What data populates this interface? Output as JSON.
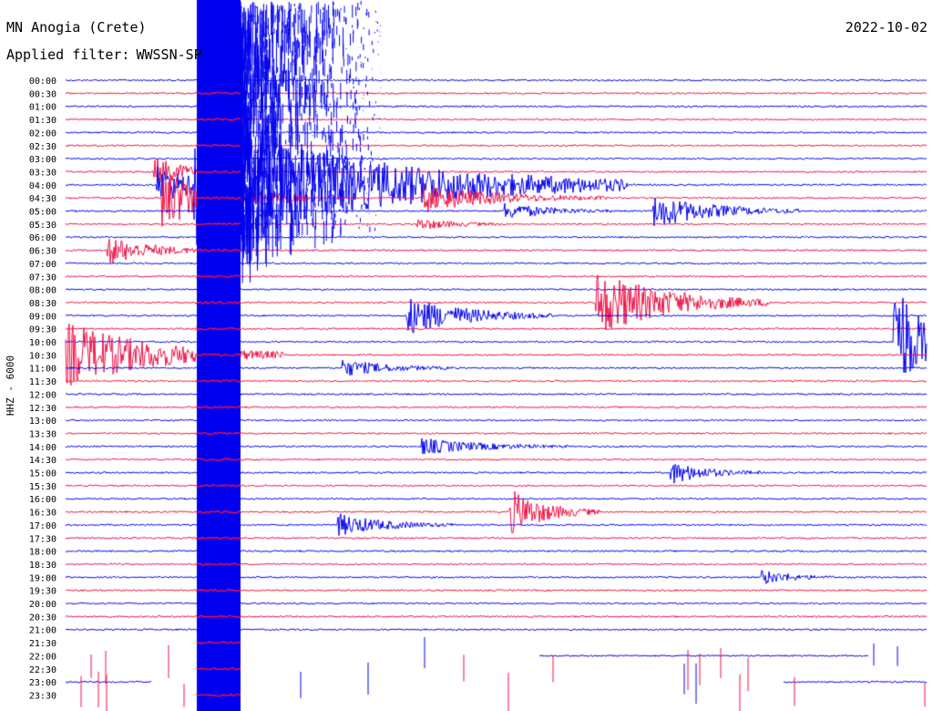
{
  "header": {
    "station": "MN Anogia (Crete)",
    "date": "2022-10-02",
    "filter_label": "Applied filter:",
    "filter_value": "WWSSN-SP"
  },
  "chart_data": {
    "type": "line",
    "title": "MN Anogia (Crete)",
    "ylabel": "HHZ - 6000",
    "rows": [
      "00:00",
      "00:30",
      "01:00",
      "01:30",
      "02:00",
      "02:30",
      "03:00",
      "03:30",
      "04:00",
      "04:30",
      "05:00",
      "05:30",
      "06:00",
      "06:30",
      "07:00",
      "07:30",
      "08:00",
      "08:30",
      "09:00",
      "09:30",
      "10:00",
      "10:30",
      "11:00",
      "11:30",
      "12:00",
      "12:30",
      "13:00",
      "13:30",
      "14:00",
      "14:30",
      "15:00",
      "15:30",
      "16:00",
      "16:30",
      "17:00",
      "17:30",
      "18:00",
      "18:30",
      "19:00",
      "19:30",
      "20:00",
      "20:30",
      "21:00",
      "21:30",
      "22:00",
      "22:30",
      "23:00",
      "23:30"
    ],
    "row_minutes": 30,
    "colors": {
      "even_row": "#0000ee",
      "odd_row": "#ee1144",
      "text": "#000000"
    },
    "data_gap": {
      "start": "21:00",
      "end": "24:00",
      "note": "rows 21:30 onward largely missing except fragments"
    },
    "events": [
      {
        "row": "03:30",
        "minute": 3.2,
        "amp": 1.0,
        "dur": 1.2
      },
      {
        "row": "04:00",
        "minute": 3.3,
        "amp": 1.4,
        "dur": 1.5
      },
      {
        "row": "04:30",
        "minute": 3.5,
        "amp": 2.2,
        "dur": 2.0
      },
      {
        "row": "04:00",
        "minute": 4.6,
        "amp": 5.0,
        "dur": 6.0
      },
      {
        "row": "04:30",
        "minute": 12.6,
        "amp": 1.0,
        "dur": 2.5
      },
      {
        "row": "05:00",
        "minute": 15.4,
        "amp": 0.6,
        "dur": 1.5
      },
      {
        "row": "05:00",
        "minute": 20.6,
        "amp": 1.2,
        "dur": 2.0
      },
      {
        "row": "05:30",
        "minute": 12.4,
        "amp": 0.4,
        "dur": 1.2
      },
      {
        "row": "06:30",
        "minute": 1.6,
        "amp": 1.0,
        "dur": 1.5
      },
      {
        "row": "08:30",
        "minute": 18.6,
        "amp": 2.5,
        "dur": 2.4
      },
      {
        "row": "09:00",
        "minute": 12.0,
        "amp": 1.4,
        "dur": 2.0
      },
      {
        "row": "10:00",
        "minute": 29.0,
        "amp": 5.0,
        "dur": 0.8
      },
      {
        "row": "10:30",
        "minute": 0.1,
        "amp": 2.5,
        "dur": 3.0
      },
      {
        "row": "11:00",
        "minute": 9.8,
        "amp": 0.6,
        "dur": 1.5
      },
      {
        "row": "14:00",
        "minute": 12.5,
        "amp": 0.6,
        "dur": 2.0
      },
      {
        "row": "15:00",
        "minute": 21.2,
        "amp": 0.8,
        "dur": 1.2
      },
      {
        "row": "16:30",
        "minute": 15.6,
        "amp": 1.6,
        "dur": 1.2
      },
      {
        "row": "17:00",
        "minute": 9.6,
        "amp": 0.8,
        "dur": 1.6
      },
      {
        "row": "19:00",
        "minute": 24.4,
        "amp": 0.5,
        "dur": 1.0
      }
    ],
    "large_event": {
      "row": "04:00",
      "minute": 4.5,
      "note": "large teleseismic event saturating rows 00:00–23:30 between minutes 4.5 and 6.0"
    }
  }
}
